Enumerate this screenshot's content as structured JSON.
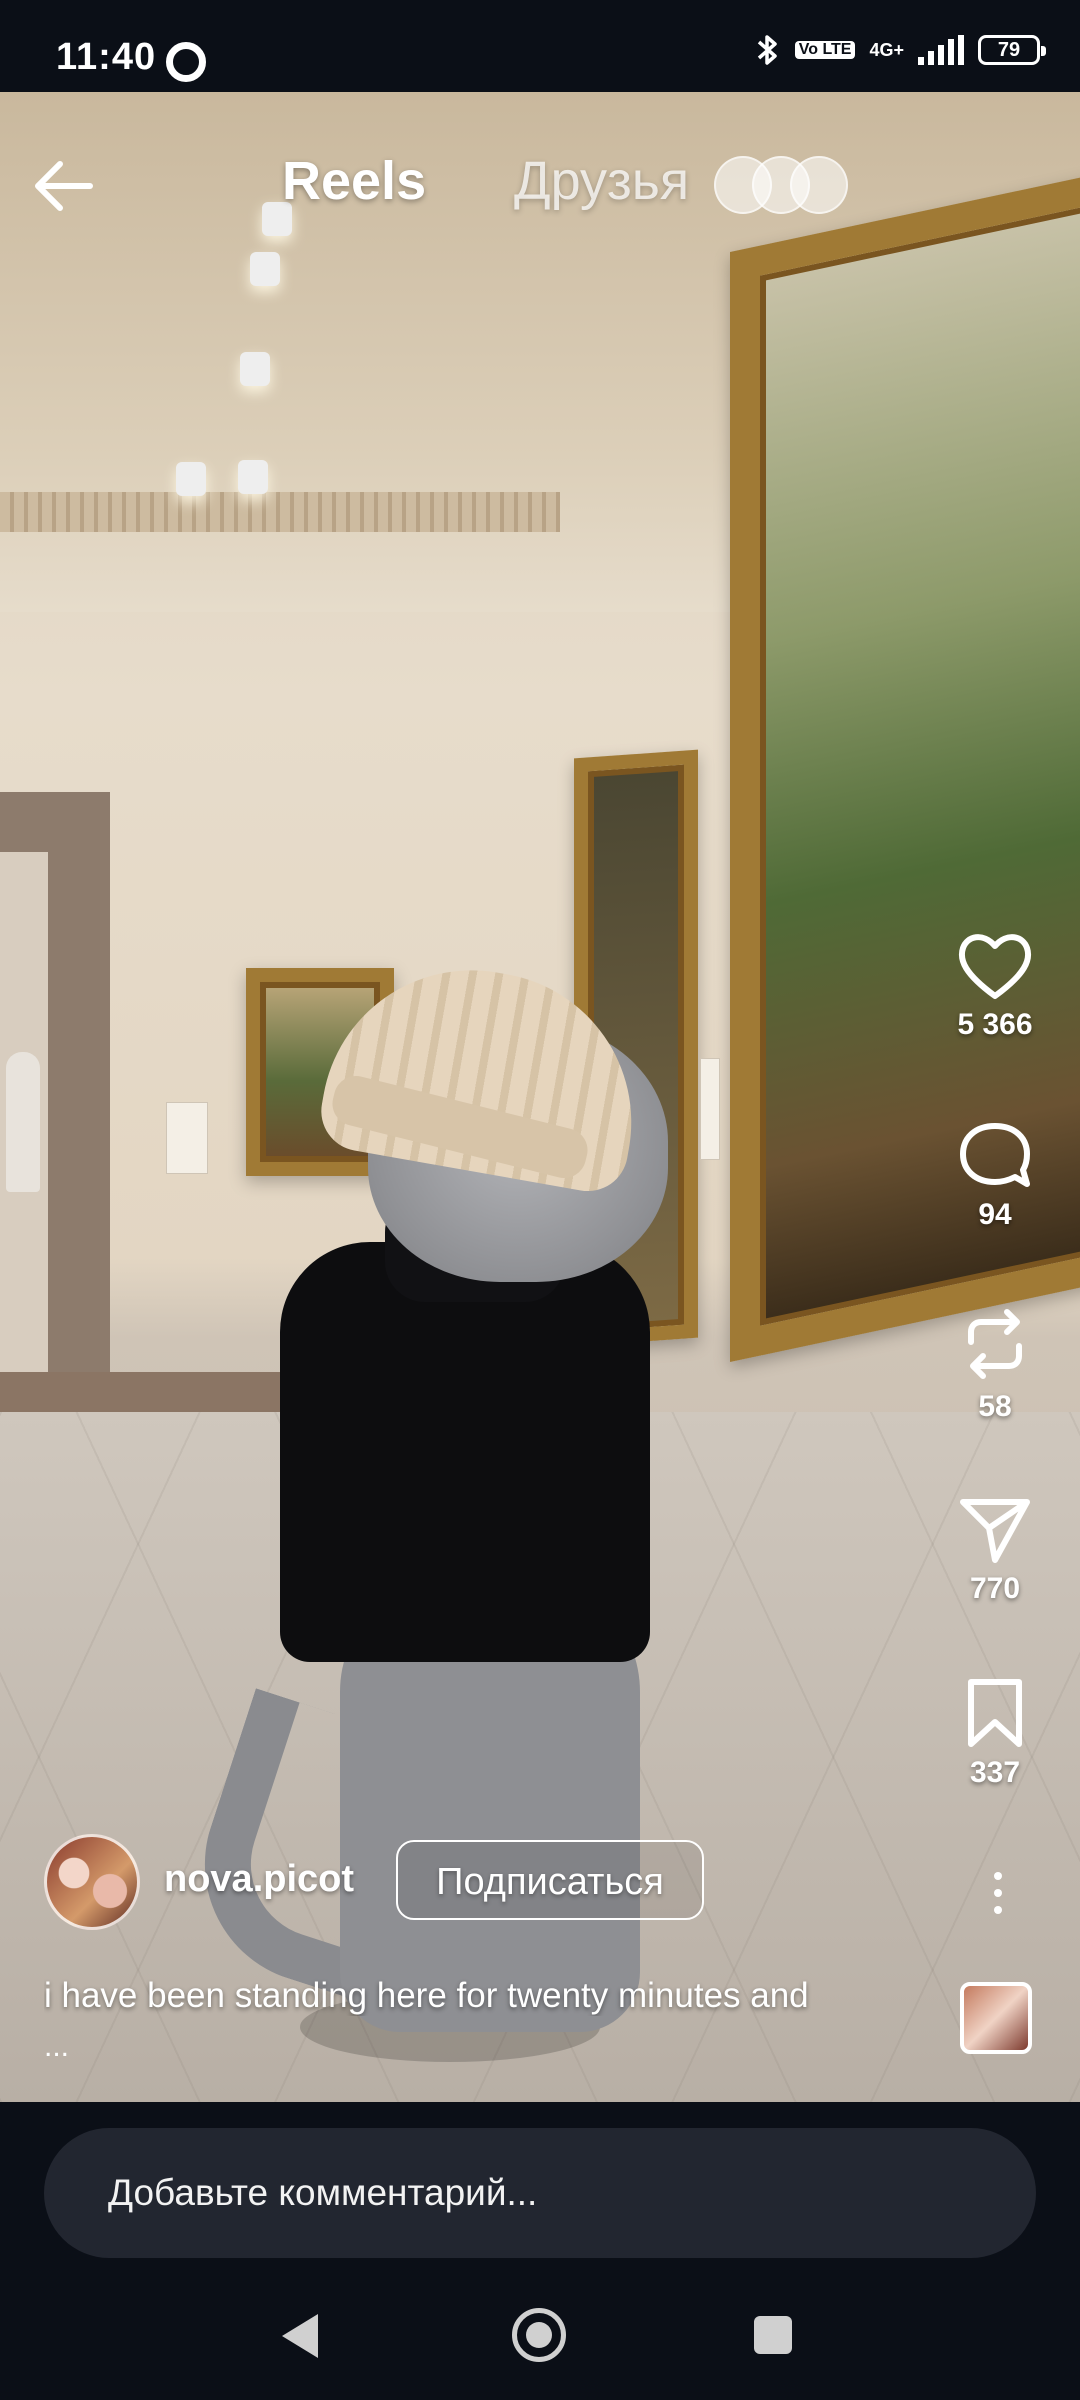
{
  "status_bar": {
    "time": "11:40",
    "network": "4G+",
    "volte": "Vo LTE",
    "battery": "79"
  },
  "header": {
    "back_icon": "arrow-left-icon",
    "tab_reels": "Reels",
    "tab_friends": "Друзья"
  },
  "actions": {
    "like_count": "5 366",
    "comment_count": "94",
    "repost_count": "58",
    "share_count": "770",
    "save_count": "337"
  },
  "post": {
    "username": "nova.picot",
    "follow_label": "Подписаться",
    "caption": "i have been standing here for twenty minutes and",
    "caption_more": "..."
  },
  "comment": {
    "placeholder": "Добавьте комментарий..."
  },
  "colors": {
    "background": "#0b0f17",
    "comment_field": "#222630",
    "text": "#ffffff"
  }
}
